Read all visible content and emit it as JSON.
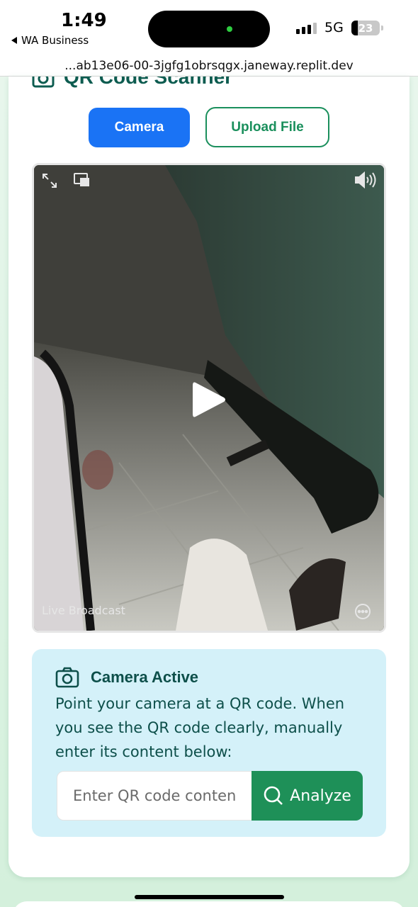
{
  "status_bar": {
    "time": "1:49",
    "back_app": "WA Business",
    "network": "5G",
    "battery": "23"
  },
  "browser": {
    "url": "...ab13e06-00-3jgfg1obrsqgx.janeway.replit.dev"
  },
  "scanner": {
    "title": "QR Code Scanner",
    "title_icon": "camera-icon",
    "mode_buttons": {
      "camera": "Camera",
      "upload": "Upload File"
    },
    "video": {
      "live_label": "Live Broadcast",
      "icons": [
        "expand-icon",
        "picture-in-picture-icon",
        "volume-icon",
        "play-icon",
        "more-icon"
      ]
    },
    "info": {
      "heading": "Camera Active",
      "heading_icon": "camera-icon",
      "text": "Point your camera at a QR code. When you see the QR code clearly, manually enter its content below:",
      "input_placeholder": "Enter QR code content",
      "input_value": "",
      "analyze_label": "Analyze",
      "analyze_icon": "search-icon"
    }
  },
  "colors": {
    "primary_blue": "#1a73f5",
    "brand_green": "#1e9058",
    "title_teal": "#0d5c50",
    "info_bg": "#d4f1f9"
  }
}
